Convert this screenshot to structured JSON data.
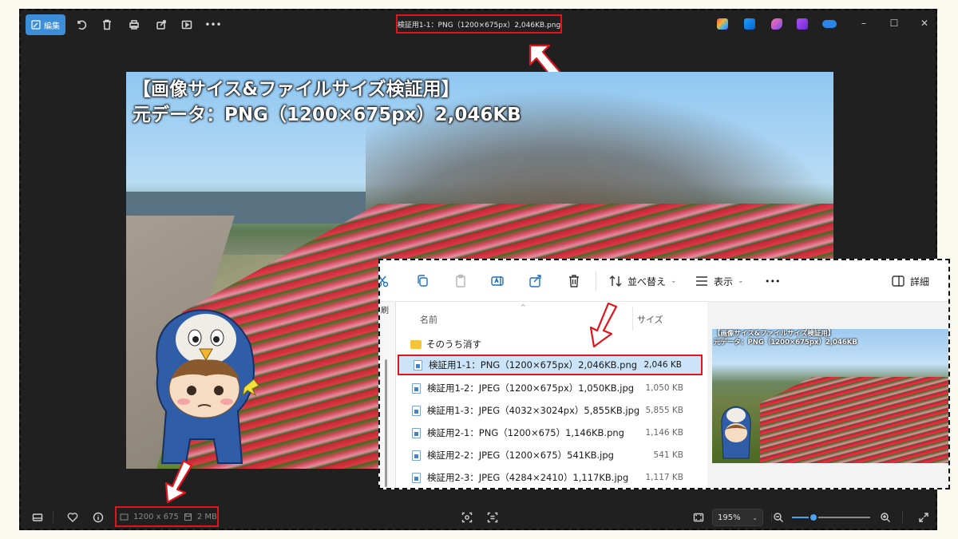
{
  "viewer": {
    "edit_label": "編集",
    "title": "検証用1-1：PNG（1200×675px）2,046KB.png",
    "photo_caption_line1": "【画像サイス&ファイルサイズ検証用】",
    "photo_caption_line2": "元データ：PNG（1200×675px）2,046KB",
    "info_dimensions": "1200 x 675",
    "info_size": "2 MB",
    "zoom_level": "195%",
    "zoom_fraction": 0.28,
    "accent": "#3b8ed7",
    "highlight": "#e3141b"
  },
  "explorer": {
    "toolbar": {
      "sort_label": "並べ替え",
      "view_label": "表示",
      "more_label": "•••",
      "details_label": "詳細"
    },
    "left_label": "刷",
    "columns": {
      "name": "名前",
      "size": "サイズ"
    },
    "folder_name": "そのうち消す",
    "files": [
      {
        "name": "検証用1-1：PNG（1200×675px）2,046KB.png",
        "size": "2,046 KB",
        "selected": true
      },
      {
        "name": "検証用1-2：JPEG（1200×675px）1,050KB.jpg",
        "size": "1,050 KB"
      },
      {
        "name": "検証用1-3：JPEG（4032×3024px）5,855KB.jpg",
        "size": "5,855 KB"
      },
      {
        "name": "検証用2-1：PNG（1200×675）1,146KB.png",
        "size": "1,146 KB"
      },
      {
        "name": "検証用2-2：JPEG（1200×675）541KB.jpg",
        "size": "541 KB"
      },
      {
        "name": "検証用2-3：JPEG（4284×2410）1,117KB.jpg",
        "size": "1,117 KB"
      }
    ],
    "preview_caption_line1": "【画像サイス&ファイルサイズ検証用】",
    "preview_caption_line2": "元データ：PNG（1200×675px）2,046KB"
  }
}
